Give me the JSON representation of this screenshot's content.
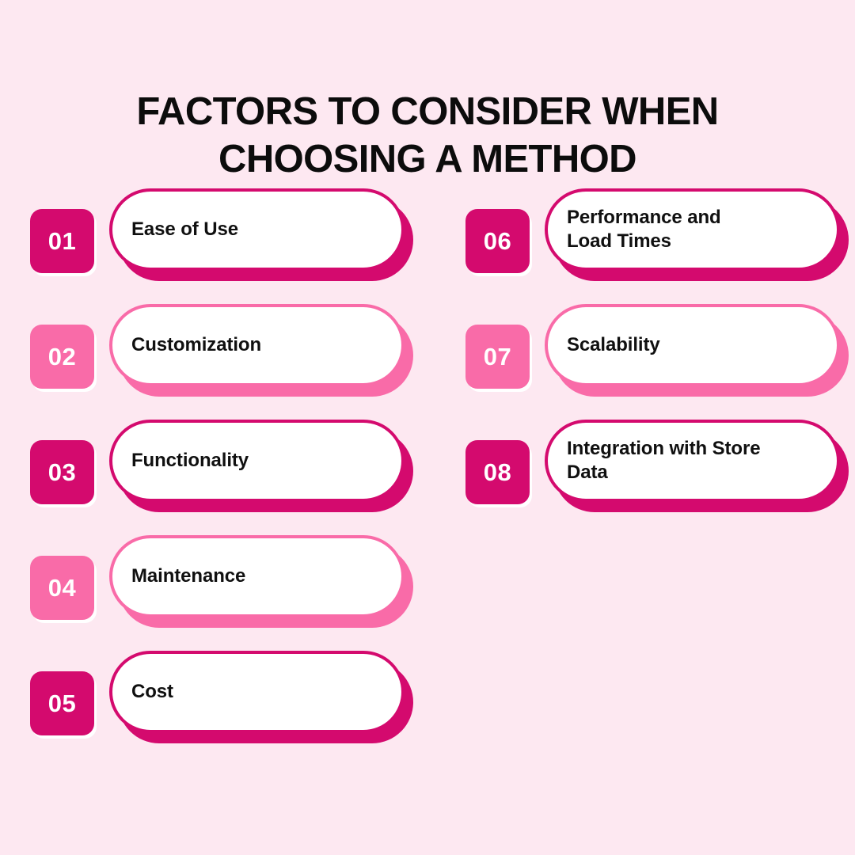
{
  "title": {
    "line1": "FACTORS TO CONSIDER WHEN",
    "line2": "CHOOSING A METHOD"
  },
  "colors": {
    "background": "#FDE8F1",
    "accent_dark": "#D40A6E",
    "accent_light": "#F96BA8",
    "badge_text": "#FFFFFF",
    "label_text": "#101010",
    "title_text": "#0C0C0C",
    "pill_fill": "#FFFFFF"
  },
  "columns": {
    "left": [
      {
        "number": "01",
        "label_line1": "Ease of Use",
        "label_line2": "",
        "tone": "dark"
      },
      {
        "number": "02",
        "label_line1": "Customization",
        "label_line2": "",
        "tone": "light"
      },
      {
        "number": "03",
        "label_line1": "Functionality",
        "label_line2": "",
        "tone": "dark"
      },
      {
        "number": "04",
        "label_line1": "Maintenance",
        "label_line2": "",
        "tone": "light"
      },
      {
        "number": "05",
        "label_line1": "Cost",
        "label_line2": "",
        "tone": "dark"
      }
    ],
    "right": [
      {
        "number": "06",
        "label_line1": "Performance and",
        "label_line2": "Load Times",
        "tone": "dark"
      },
      {
        "number": "07",
        "label_line1": "Scalability",
        "label_line2": "",
        "tone": "light"
      },
      {
        "number": "08",
        "label_line1": "Integration with Store",
        "label_line2": "Data",
        "tone": "dark"
      }
    ]
  }
}
